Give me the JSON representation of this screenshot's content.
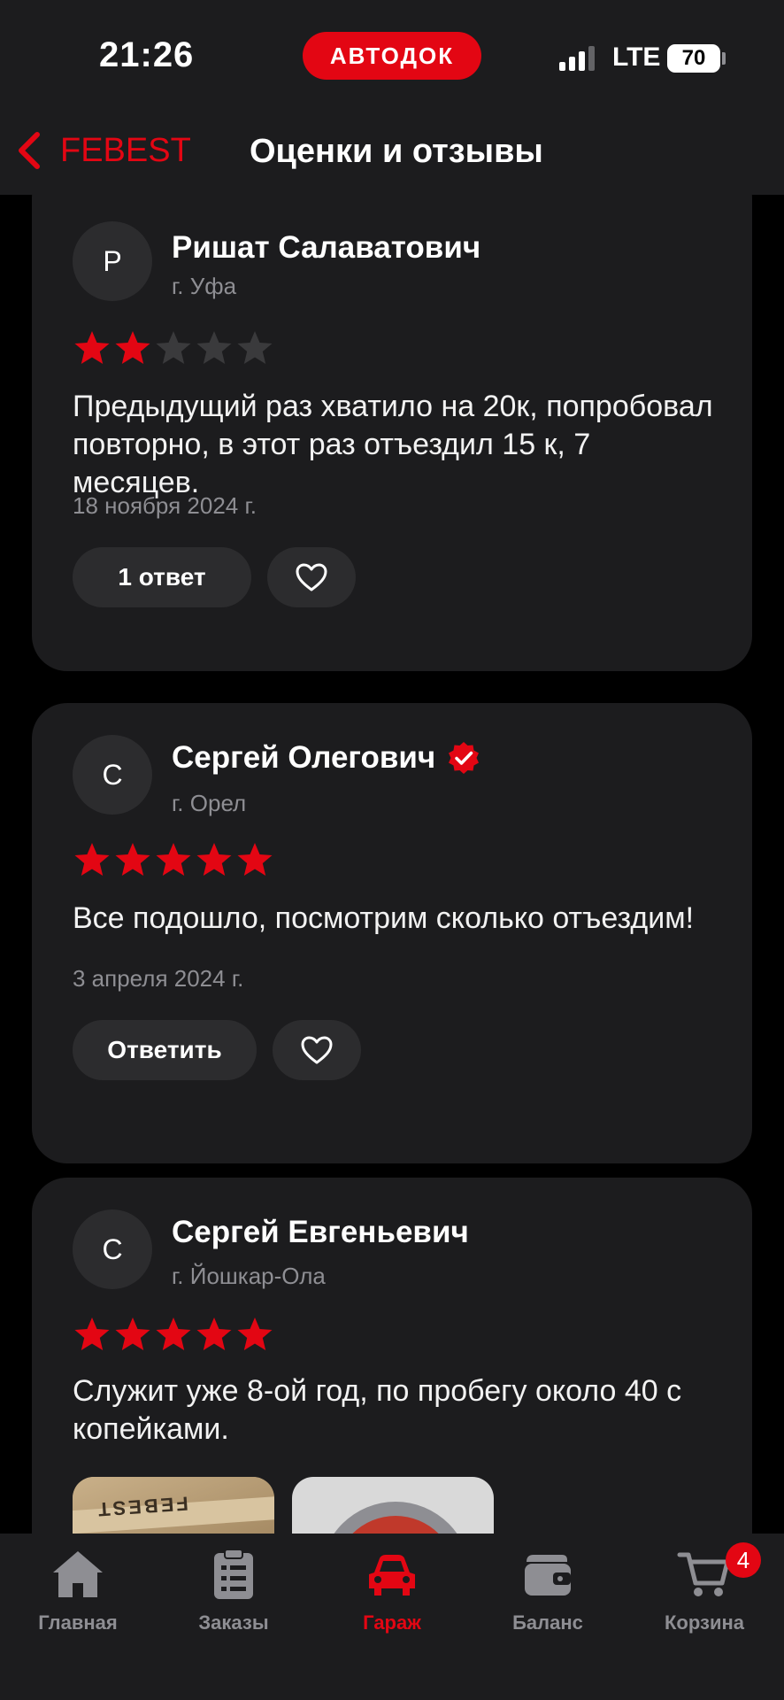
{
  "status_bar": {
    "time": "21:26",
    "brand": "АВТОДОК",
    "network": "LTE",
    "battery": "70"
  },
  "header": {
    "back_label": "FEBEST",
    "title": "Оценки и отзывы"
  },
  "reviews": [
    {
      "initial": "Р",
      "author": "Ришат Салаватович",
      "city": "г. Уфа",
      "rating": 2,
      "text": "Предыдущий раз хватило на 20к, попробовал повторно, в этот раз отъездил 15 к, 7 месяцев.",
      "date": "18 ноября 2024 г.",
      "reply_label": "1 ответ",
      "verified": false
    },
    {
      "initial": "С",
      "author": "Сергей Олегович",
      "city": "г. Орел",
      "rating": 5,
      "text": "Все подошло, посмотрим сколько отъездим!",
      "date": "3 апреля 2024 г.",
      "reply_label": "Ответить",
      "verified": true
    },
    {
      "initial": "С",
      "author": "Сергей Евгеньевич",
      "city": "г. Йошкар-Ола",
      "rating": 5,
      "text": "Служит уже 8-ой год, по пробегу около 40 с копейками.",
      "photo_box_text": "FEBEST"
    }
  ],
  "tab_bar": {
    "items": [
      {
        "label": "Главная",
        "icon": "home-icon"
      },
      {
        "label": "Заказы",
        "icon": "orders-icon"
      },
      {
        "label": "Гараж",
        "icon": "car-icon",
        "active": true
      },
      {
        "label": "Баланс",
        "icon": "wallet-icon"
      },
      {
        "label": "Корзина",
        "icon": "cart-icon"
      }
    ],
    "cart_count": "4"
  },
  "colors": {
    "accent": "#e30613",
    "background": "#000000",
    "card": "#1c1c1e",
    "button": "#2c2c2e",
    "muted": "#8e8e93",
    "star_empty": "#3a3a3c"
  }
}
